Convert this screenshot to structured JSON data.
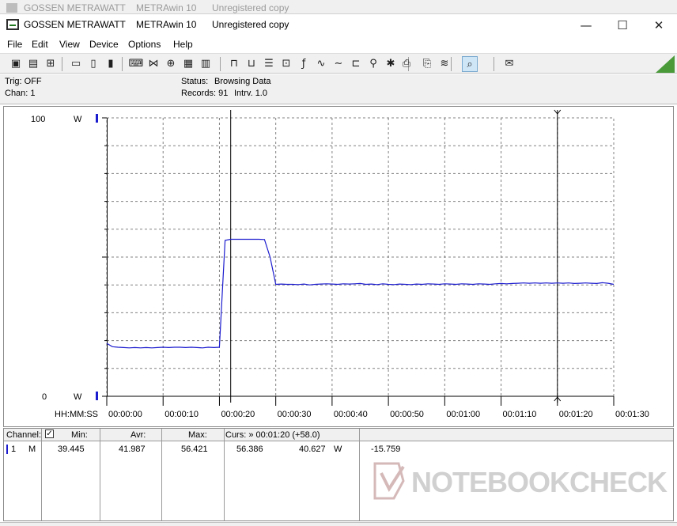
{
  "ghost_window": {
    "company": "GOSSEN METRAWATT",
    "app": "METRAwin 10",
    "license": "Unregistered copy"
  },
  "window": {
    "company": "GOSSEN METRAWATT",
    "app": "METRAwin 10",
    "license": "Unregistered copy",
    "minimize": "—",
    "maximize": "☐",
    "close": "✕"
  },
  "menu": [
    "File",
    "Edit",
    "View",
    "Device",
    "Options",
    "Help"
  ],
  "toolbar": {
    "buttons": [
      {
        "icon": "open-icon",
        "glyph": "▣"
      },
      {
        "icon": "save-icon",
        "glyph": "▤"
      },
      {
        "icon": "folder-icon",
        "glyph": "⊞"
      },
      {
        "icon": "device-connect-icon",
        "glyph": "▭"
      },
      {
        "icon": "device-read-icon",
        "glyph": "▯"
      },
      {
        "icon": "device-config-icon",
        "glyph": "▮"
      },
      {
        "icon": "keyboard-icon",
        "glyph": "⌨"
      },
      {
        "icon": "scan-icon",
        "glyph": "⋈"
      },
      {
        "icon": "grid-icon",
        "glyph": "⊕"
      },
      {
        "icon": "table-icon",
        "glyph": "▦"
      },
      {
        "icon": "bars-icon",
        "glyph": "▥"
      },
      {
        "icon": "trigger-icon",
        "glyph": "⊓"
      },
      {
        "icon": "record-icon",
        "glyph": "⊔"
      },
      {
        "icon": "list-icon",
        "glyph": "☰"
      },
      {
        "icon": "monitor-icon",
        "glyph": "⊡"
      },
      {
        "icon": "math-icon",
        "glyph": "ƒ"
      },
      {
        "icon": "wave-icon",
        "glyph": "∿"
      },
      {
        "icon": "sine-icon",
        "glyph": "∼"
      },
      {
        "icon": "step-icon",
        "glyph": "⊏"
      },
      {
        "icon": "zoom-icon",
        "glyph": "⚲"
      },
      {
        "icon": "cursor-icon",
        "glyph": "✱"
      },
      {
        "icon": "print-icon",
        "glyph": "⎙"
      },
      {
        "icon": "print-preview-icon",
        "glyph": "⎘"
      },
      {
        "icon": "signal-icon",
        "glyph": "≋"
      },
      {
        "icon": "scope-icon",
        "glyph": "⌕"
      },
      {
        "icon": "message-icon",
        "glyph": "✉"
      }
    ]
  },
  "info": {
    "trig": "Trig: OFF",
    "chan": "Chan:  1",
    "status_label": "Status:",
    "status_value": "Browsing Data",
    "records_label": "Records: 91",
    "interval_label": "Intrv. 1.0"
  },
  "chart": {
    "y_top": "100",
    "y_bottom": "0",
    "unit_top": "W",
    "unit_bottom": "W",
    "x_axis_label": "HH:MM:SS",
    "x_ticks": [
      "00:00:00",
      "00:00:10",
      "00:00:20",
      "00:00:30",
      "00:00:40",
      "00:00:50",
      "00:01:00",
      "00:01:10",
      "00:01:20",
      "00:01:30"
    ],
    "line_color": "#1c1ccf",
    "grid_color": "#808080"
  },
  "chart_data": {
    "type": "line",
    "x_unit": "seconds",
    "ylim": [
      0,
      100
    ],
    "xlim": [
      0,
      90
    ],
    "series": [
      {
        "values": [
          [
            0,
            19
          ],
          [
            1,
            17.8
          ],
          [
            2,
            17.6
          ],
          [
            3,
            17.5
          ],
          [
            4,
            17.4
          ],
          [
            5,
            17.5
          ],
          [
            6,
            17.4
          ],
          [
            7,
            17.5
          ],
          [
            8,
            17.4
          ],
          [
            9,
            17.5
          ],
          [
            10,
            17.6
          ],
          [
            11,
            17.5
          ],
          [
            12,
            17.6
          ],
          [
            13,
            17.6
          ],
          [
            14,
            17.5
          ],
          [
            15,
            17.6
          ],
          [
            16,
            17.5
          ],
          [
            17,
            17.4
          ],
          [
            18,
            17.6
          ],
          [
            19,
            17.5
          ],
          [
            20,
            17.6
          ],
          [
            21,
            56.0
          ],
          [
            22,
            56.4
          ],
          [
            23,
            56.4
          ],
          [
            24,
            56.4
          ],
          [
            25,
            56.4
          ],
          [
            26,
            56.4
          ],
          [
            27,
            56.4
          ],
          [
            28,
            56.3
          ],
          [
            29,
            50.0
          ],
          [
            30,
            40.2
          ],
          [
            31,
            40.3
          ],
          [
            32,
            40.2
          ],
          [
            33,
            40.2
          ],
          [
            34,
            40.1
          ],
          [
            35,
            40.3
          ],
          [
            36,
            40.0
          ],
          [
            37,
            40.2
          ],
          [
            38,
            40.3
          ],
          [
            39,
            40.4
          ],
          [
            40,
            40.3
          ],
          [
            41,
            40.2
          ],
          [
            42,
            40.4
          ],
          [
            43,
            40.3
          ],
          [
            44,
            40.4
          ],
          [
            45,
            40.5
          ],
          [
            46,
            40.2
          ],
          [
            47,
            40.3
          ],
          [
            48,
            40.1
          ],
          [
            49,
            40.4
          ],
          [
            50,
            40.2
          ],
          [
            51,
            40.1
          ],
          [
            52,
            40.3
          ],
          [
            53,
            40.2
          ],
          [
            54,
            40.1
          ],
          [
            55,
            40.3
          ],
          [
            56,
            40.2
          ],
          [
            57,
            40.4
          ],
          [
            58,
            40.3
          ],
          [
            59,
            40.2
          ],
          [
            60,
            40.4
          ],
          [
            61,
            40.3
          ],
          [
            62,
            40.2
          ],
          [
            63,
            40.4
          ],
          [
            64,
            40.3
          ],
          [
            65,
            40.2
          ],
          [
            66,
            40.4
          ],
          [
            67,
            40.3
          ],
          [
            68,
            40.2
          ],
          [
            69,
            40.4
          ],
          [
            70,
            40.5
          ],
          [
            71,
            40.4
          ],
          [
            72,
            40.5
          ],
          [
            73,
            40.6
          ],
          [
            74,
            40.7
          ],
          [
            75,
            40.6
          ],
          [
            76,
            40.7
          ],
          [
            77,
            40.6
          ],
          [
            78,
            40.7
          ],
          [
            79,
            40.6
          ],
          [
            80,
            40.7
          ],
          [
            81,
            40.6
          ],
          [
            82,
            40.7
          ],
          [
            83,
            40.5
          ],
          [
            84,
            40.6
          ],
          [
            85,
            40.7
          ],
          [
            86,
            40.6
          ],
          [
            87,
            40.5
          ],
          [
            88,
            40.8
          ],
          [
            89,
            40.6
          ],
          [
            90,
            40.2
          ]
        ]
      }
    ],
    "cursors_x": [
      22,
      80
    ]
  },
  "stats": {
    "channel_label": "Channel:",
    "min_label": "Min:",
    "avr_label": "Avr:",
    "max_label": "Max:",
    "cursor_label": "Curs: » 00:01:20 (+58.0)",
    "row": {
      "channel": "1",
      "mode": "M",
      "min": "39.445",
      "avr": "41.987",
      "max": "56.421",
      "cursor_value": "56.386",
      "cursor_value2": "40.627",
      "unit": "W",
      "delta": "-15.759"
    }
  },
  "watermark": {
    "text": "NOTEBOOKCHECK"
  }
}
